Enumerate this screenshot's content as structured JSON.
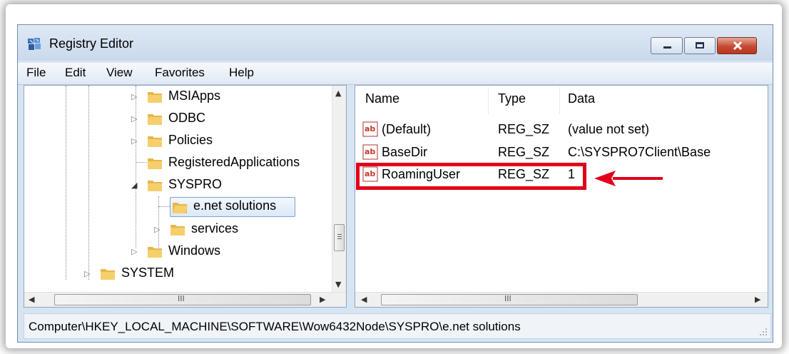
{
  "window": {
    "title": "Registry Editor"
  },
  "menu": {
    "items": [
      "File",
      "Edit",
      "View",
      "Favorites",
      "Help"
    ]
  },
  "tree": {
    "items": [
      {
        "label": "MSIApps",
        "expander": "collapsed"
      },
      {
        "label": "ODBC",
        "expander": "collapsed"
      },
      {
        "label": "Policies",
        "expander": "collapsed"
      },
      {
        "label": "RegisteredApplications",
        "expander": "none"
      },
      {
        "label": "SYSPRO",
        "expander": "expanded"
      },
      {
        "label": "e.net solutions",
        "expander": "none",
        "selected": true
      },
      {
        "label": "services",
        "expander": "collapsed"
      },
      {
        "label": "Windows",
        "expander": "collapsed"
      },
      {
        "label": "SYSTEM",
        "expander": "collapsed"
      }
    ],
    "hscroll_grip": "III"
  },
  "values": {
    "columns": [
      "Name",
      "Type",
      "Data"
    ],
    "rows": [
      {
        "name": "(Default)",
        "type": "REG_SZ",
        "data": "(value not set)"
      },
      {
        "name": "BaseDir",
        "type": "REG_SZ",
        "data": "C:\\SYSPRO7Client\\Base"
      },
      {
        "name": "RoamingUser",
        "type": "REG_SZ",
        "data": "1",
        "highlighted": true
      }
    ],
    "hscroll_grip": "III"
  },
  "status": {
    "path": "Computer\\HKEY_LOCAL_MACHINE\\SOFTWARE\\Wow6432Node\\SYSPRO\\e.net solutions"
  },
  "colors": {
    "accent_highlight": "#e0001a",
    "selection_border": "#7da2ce",
    "folder": "#e8b64a"
  },
  "icons": {
    "app": "registry-editor-icon",
    "value": "string-value-ab-icon",
    "folder": "folder-icon",
    "annotation": "red-arrow-icon"
  }
}
